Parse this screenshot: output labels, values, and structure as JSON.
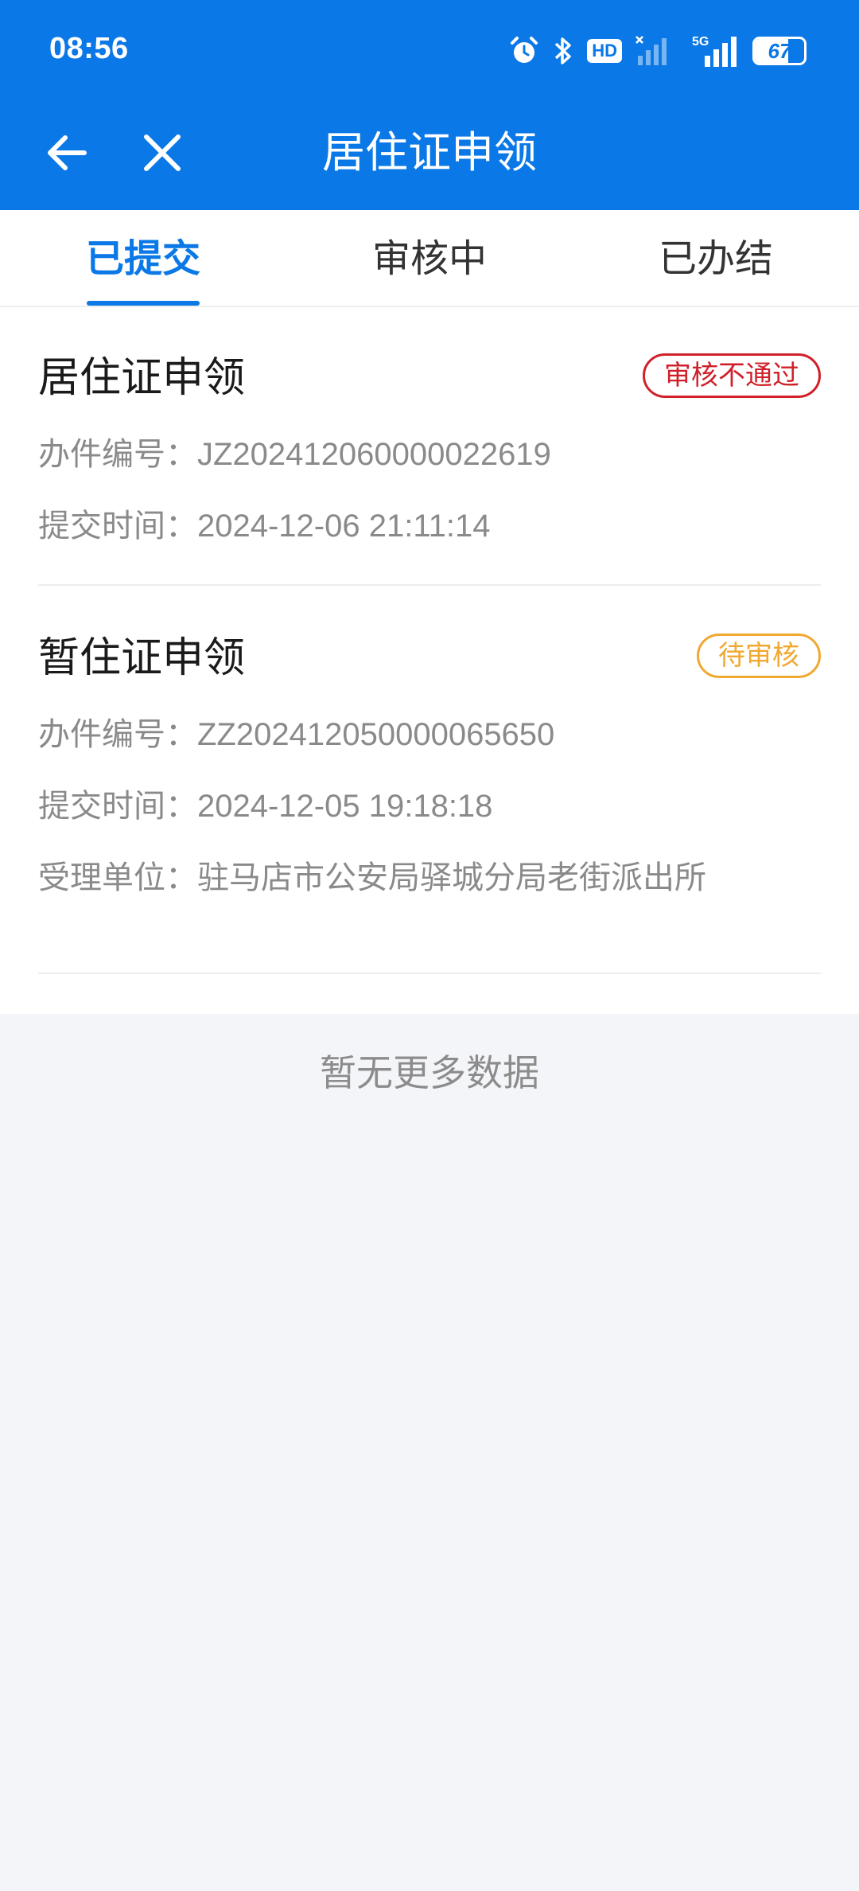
{
  "status_bar": {
    "time": "08:56",
    "hd_label": "HD",
    "network_label": "5G",
    "battery": "67",
    "battery_level": 0.67
  },
  "header": {
    "title": "居住证申领",
    "back_icon": "arrow-left-icon",
    "close_icon": "close-icon"
  },
  "tabs": [
    {
      "label": "已提交",
      "active": true
    },
    {
      "label": "审核中",
      "active": false
    },
    {
      "label": "已办结",
      "active": false
    }
  ],
  "records": [
    {
      "title": "居住证申领",
      "status": "审核不通过",
      "rows": [
        {
          "label": "办件编号：",
          "value": "JZ202412060000022619"
        },
        {
          "label": "提交时间：",
          "value": "2024-12-06 21:11:14"
        }
      ]
    },
    {
      "title": "暂住证申领",
      "status": "待审核",
      "rows": [
        {
          "label": "办件编号：",
          "value": "ZZ202412050000065650"
        },
        {
          "label": "提交时间：",
          "value": "2024-12-05 19:18:18"
        },
        {
          "label": "受理单位：",
          "value": "驻马店市公安局驿城分局老街派出所"
        }
      ]
    }
  ],
  "empty_text": "暂无更多数据",
  "colors": {
    "primary": "#0a78e6",
    "reject": "#d0202a",
    "pending": "#f0a830"
  }
}
